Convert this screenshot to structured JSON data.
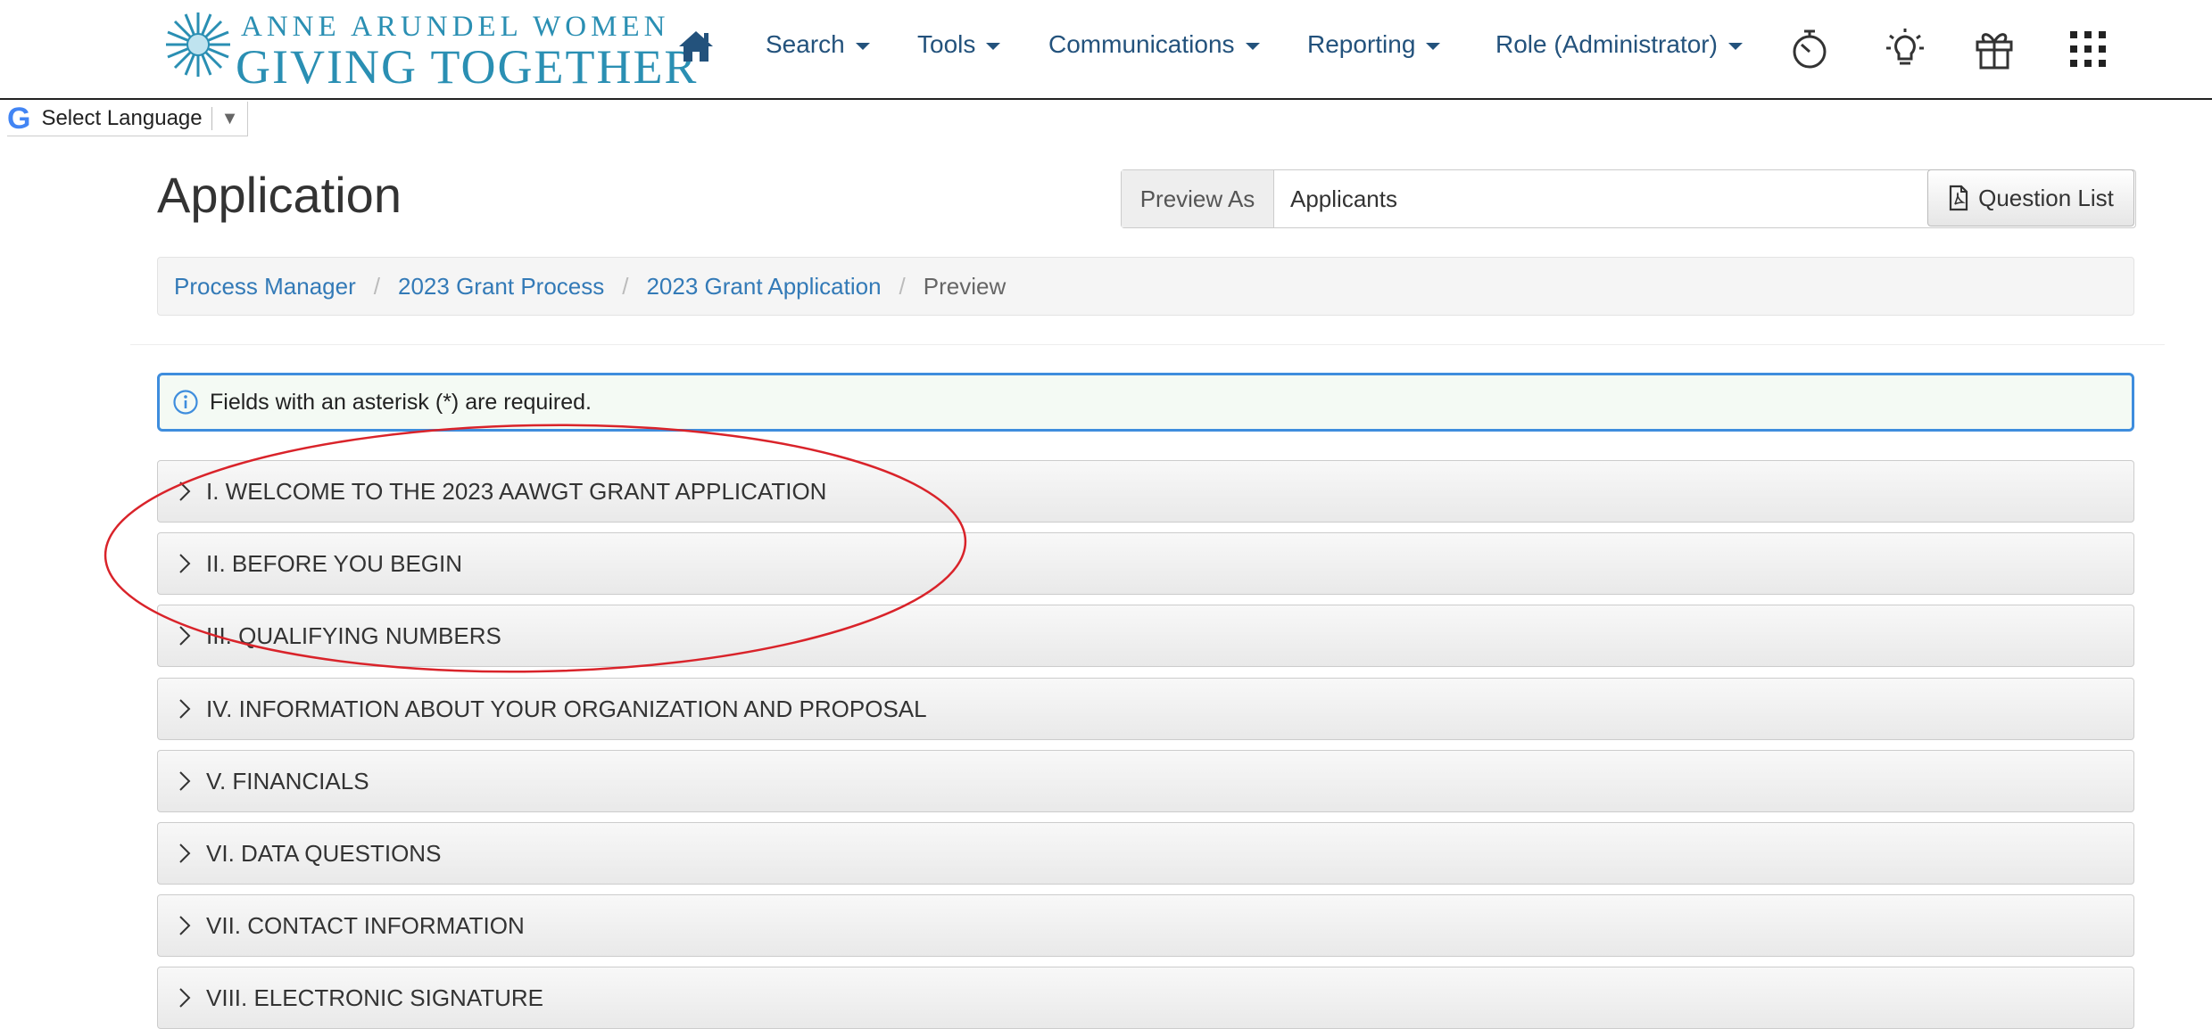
{
  "brand": {
    "line1": "ANNE ARUNDEL WOMEN",
    "line2": "GIVING TOGETHER"
  },
  "nav": {
    "items": [
      {
        "label": "Search"
      },
      {
        "label": "Tools"
      },
      {
        "label": "Communications"
      },
      {
        "label": "Reporting"
      },
      {
        "label": "Role (Administrator)"
      }
    ],
    "icons": [
      "home-icon",
      "stopwatch-icon",
      "lightbulb-icon",
      "gift-icon",
      "apps-grid-icon"
    ]
  },
  "translate": {
    "label": "Select Language",
    "arrow": "▼"
  },
  "page": {
    "title": "Application"
  },
  "preview": {
    "addon_label": "Preview As",
    "selected": "Applicants",
    "question_list_label": "Question List"
  },
  "breadcrumb": {
    "items": [
      "Process Manager",
      "2023 Grant Process",
      "2023 Grant Application"
    ],
    "active": "Preview",
    "separator": "/"
  },
  "alert": {
    "text": "Fields with an asterisk (*) are required."
  },
  "sections": [
    {
      "label": "I. WELCOME TO THE 2023 AAWGT GRANT APPLICATION"
    },
    {
      "label": "II. BEFORE YOU BEGIN"
    },
    {
      "label": "III. QUALIFYING NUMBERS"
    },
    {
      "label": "IV. INFORMATION ABOUT YOUR ORGANIZATION AND PROPOSAL"
    },
    {
      "label": "V. FINANCIALS"
    },
    {
      "label": "VI. DATA QUESTIONS"
    },
    {
      "label": "VII. CONTACT INFORMATION"
    },
    {
      "label": "VIII. ELECTRONIC SIGNATURE"
    }
  ],
  "colors": {
    "brand": "#2a8fb3",
    "link": "#337ab7",
    "nav_link": "#23527c",
    "alert_border": "#3e8ddd",
    "annotation": "#d9232a"
  }
}
